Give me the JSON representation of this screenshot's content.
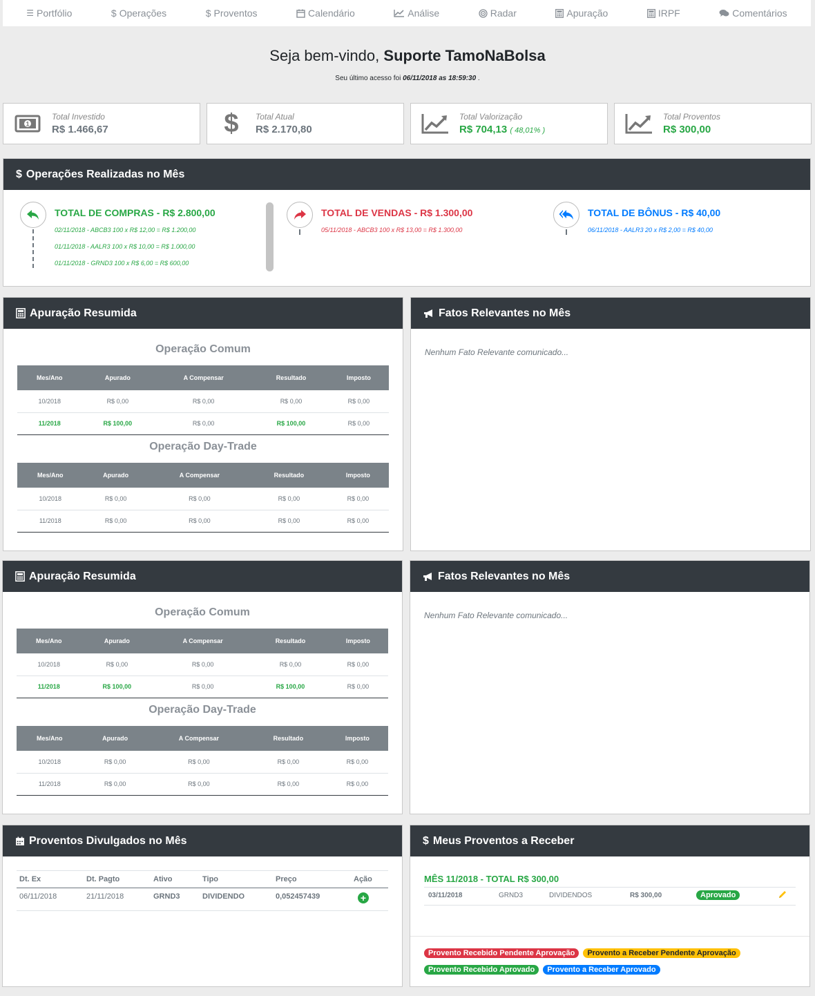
{
  "nav": [
    {
      "icon": "bars-icon",
      "label": "Portfólio"
    },
    {
      "icon": "dollar-icon",
      "label": "Operações"
    },
    {
      "icon": "dollar-icon",
      "label": "Proventos"
    },
    {
      "icon": "calendar-icon",
      "label": "Calendário"
    },
    {
      "icon": "chart-line-icon",
      "label": "Análise"
    },
    {
      "icon": "radar-icon",
      "label": "Radar"
    },
    {
      "icon": "calculator-icon",
      "label": "Apuração"
    },
    {
      "icon": "calculator-icon",
      "label": "IRPF"
    },
    {
      "icon": "comments-icon",
      "label": "Comentários"
    }
  ],
  "welcome": {
    "greeting": "Seja bem-vindo,",
    "user": "Suporte TamoNaBolsa",
    "last_access_prefix": "Seu último acesso foi",
    "last_access": "06/11/2018 as 18:59:30",
    "last_access_suffix": "."
  },
  "cards": {
    "investido": {
      "label": "Total Investido",
      "value": "R$ 1.466,67"
    },
    "atual": {
      "label": "Total Atual",
      "value": "R$ 2.170,80"
    },
    "valorizacao": {
      "label": "Total Valorização",
      "value": "R$ 704,13",
      "pct": "( 48,01% )"
    },
    "proventos": {
      "label": "Total Proventos",
      "value": "R$ 300,00"
    }
  },
  "operacoes": {
    "title": "Operações Realizadas no Mês",
    "compras": {
      "title": "TOTAL DE COMPRAS",
      "total": "R$ 2.800,00",
      "entries": [
        "02/11/2018 - ABCB3 100 x R$ 12,00 = R$ 1.200,00",
        "01/11/2018 - AALR3 100 x R$ 10,00 = R$ 1.000,00",
        "01/11/2018 - GRND3 100 x R$ 6,00 = R$ 600,00"
      ]
    },
    "vendas": {
      "title": "TOTAL DE VENDAS",
      "total": "R$ 1.300,00",
      "entries": [
        "05/11/2018 - ABCB3 100 x R$ 13,00 = R$ 1.300,00"
      ]
    },
    "bonus": {
      "title": "TOTAL DE BÔNUS",
      "total": "R$ 40,00",
      "entries": [
        "06/11/2018 - AALR3 20 x R$ 2,00 = R$ 40,00"
      ]
    }
  },
  "apuracao": {
    "title": "Apuração Resumida",
    "comum_title": "Operação Comum",
    "daytrade_title": "Operação Day-Trade",
    "columns": [
      "Mes/Ano",
      "Apurado",
      "A Compensar",
      "Resultado",
      "Imposto"
    ],
    "comum_rows": [
      [
        "10/2018",
        "R$ 0,00",
        "R$ 0,00",
        "R$ 0,00",
        "R$ 0,00"
      ],
      [
        "11/2018",
        "R$ 100,00",
        "R$ 0,00",
        "R$ 100,00",
        "R$ 0,00"
      ]
    ],
    "daytrade_rows": [
      [
        "10/2018",
        "R$ 0,00",
        "R$ 0,00",
        "R$ 0,00",
        "R$ 0,00"
      ],
      [
        "11/2018",
        "R$ 0,00",
        "R$ 0,00",
        "R$ 0,00",
        "R$ 0,00"
      ]
    ]
  },
  "fatos": {
    "title": "Fatos Relevantes no Mês",
    "empty": "Nenhum Fato Relevante comunicado..."
  },
  "proventos_divulgados": {
    "title": "Proventos Divulgados no Mês",
    "columns": [
      "Dt. Ex",
      "Dt. Pagto",
      "Ativo",
      "Tipo",
      "Preço",
      "Ação"
    ],
    "rows": [
      [
        "06/11/2018",
        "21/11/2018",
        "GRND3",
        "DIVIDENDO",
        "0,052457439"
      ]
    ]
  },
  "meus_proventos": {
    "title": "Meus Proventos a Receber",
    "mes_title": "MÊS 11/2018 - TOTAL R$ 300,00",
    "row": {
      "date": "03/11/2018",
      "ativo": "GRND3",
      "tipo": "DIVIDENDOS",
      "valor": "R$ 300,00",
      "status": "Aprovado"
    },
    "legend": [
      "Provento Recebido Pendente Aprovação",
      "Provento a Receber Pendente Aprovação",
      "Provento Recebido Aprovado",
      "Provento a Receber Aprovado"
    ]
  },
  "colors": {
    "dark_header": "#343a40",
    "green": "#28a745",
    "red": "#dc3545",
    "blue": "#007bff",
    "yellow": "#ffc107"
  }
}
